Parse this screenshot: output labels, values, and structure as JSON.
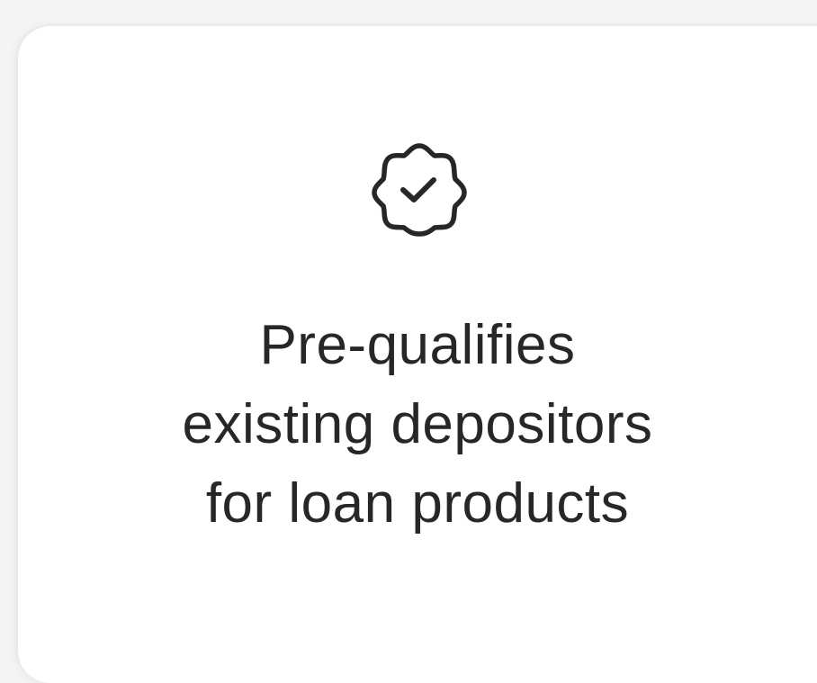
{
  "card": {
    "icon": "verified-badge-icon",
    "title_lines": [
      "Pre-qualifies",
      "existing depositors",
      "for loan products"
    ]
  },
  "colors": {
    "page_background": "#f4f4f5",
    "card_background": "#ffffff",
    "text": "#27272a"
  }
}
